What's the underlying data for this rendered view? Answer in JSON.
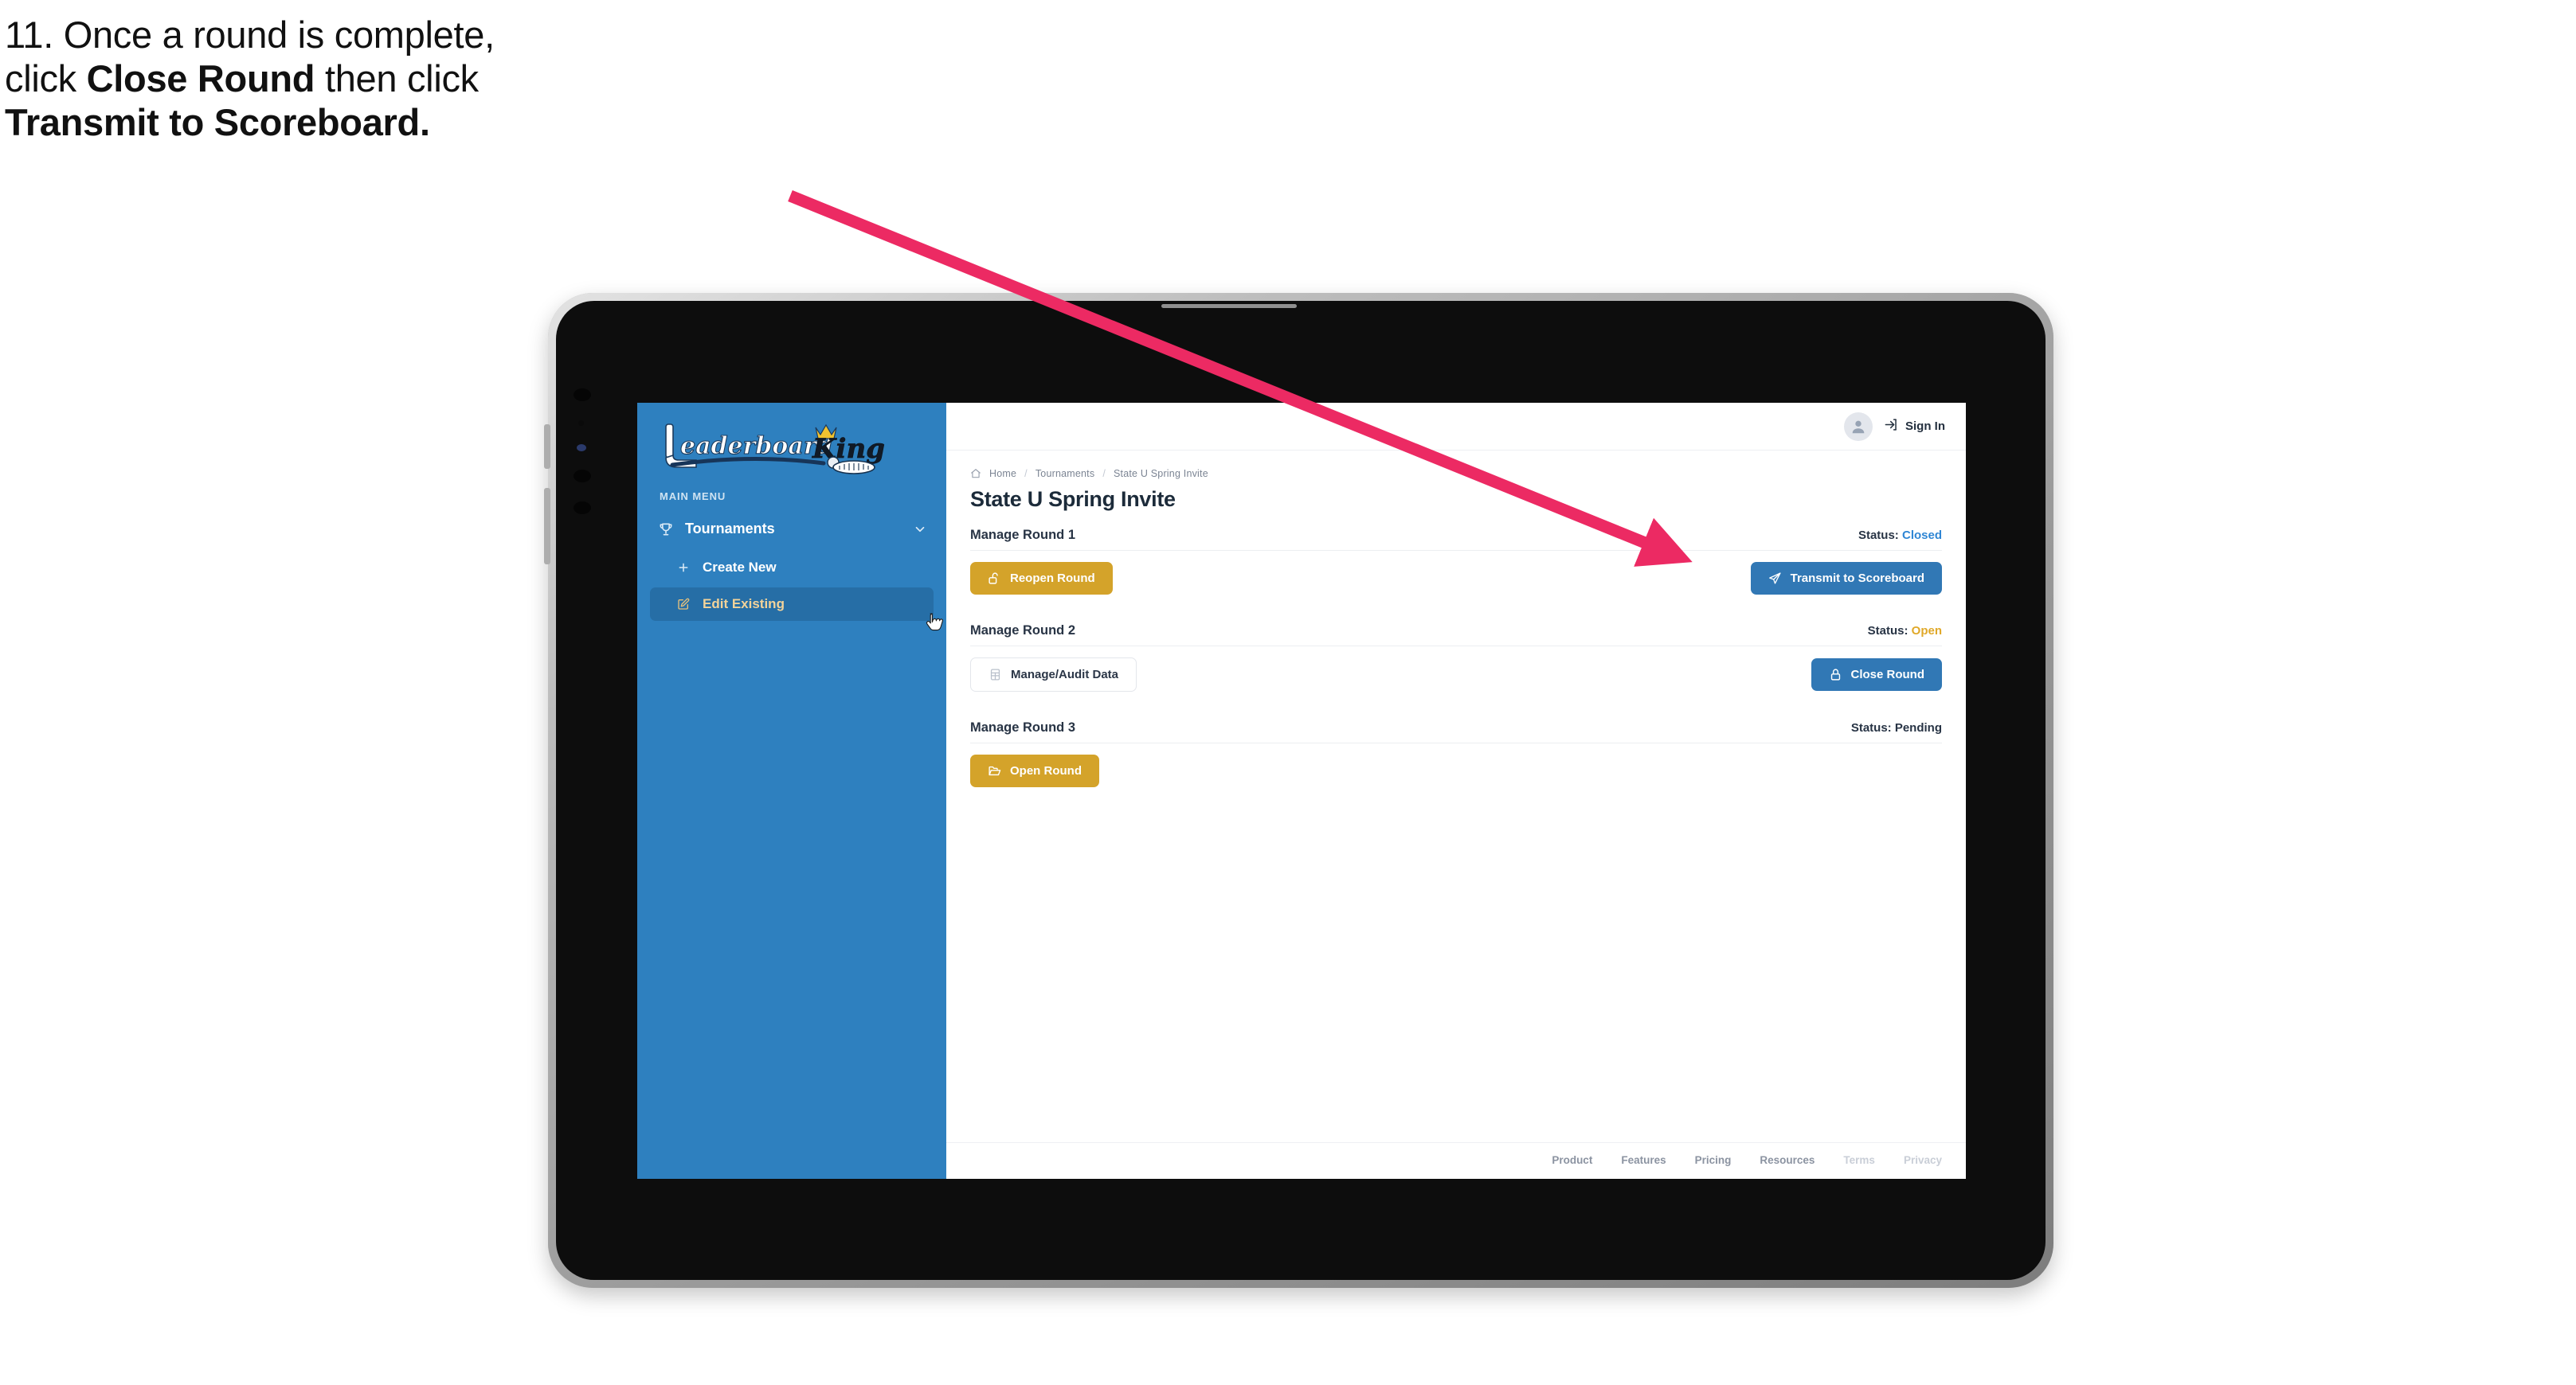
{
  "caption": {
    "line1_prefix": "11. Once a round is complete,",
    "line2_prefix": "click ",
    "line2_bold": "Close Round",
    "line2_suffix": " then click",
    "line3_bold": "Transmit to Scoreboard."
  },
  "annotation": {
    "arrow_color": "#ec2a63",
    "points_to": "Transmit to Scoreboard"
  },
  "app": {
    "sidebar": {
      "logo_text": "LeaderboardKing",
      "logo_word_1": "Leaderboard",
      "logo_word_2": "King",
      "section_label": "MAIN MENU",
      "items": [
        {
          "label": "Tournaments",
          "icon": "trophy-icon",
          "expanded": true,
          "chevron": "chevron-down-icon"
        },
        {
          "label": "Create New",
          "icon": "plus-icon",
          "active": false
        },
        {
          "label": "Edit Existing",
          "icon": "edit-pencil-icon",
          "active": true
        }
      ],
      "bg_color": "#2e80bf",
      "active_bg_color": "#266ea6",
      "active_text_color": "#f2d39a"
    },
    "topbar": {
      "avatar_icon": "user-avatar-icon",
      "signin_icon": "sign-in-arrow-icon",
      "signin_label": "Sign In"
    },
    "breadcrumb": {
      "home_icon": "home-icon",
      "items": [
        "Home",
        "Tournaments",
        "State U Spring Invite"
      ],
      "separator": "/"
    },
    "page_title": "State U Spring Invite",
    "rounds": [
      {
        "name": "Manage Round 1",
        "status_label": "Status:",
        "status_value": "Closed",
        "status_style": "closed",
        "status_color": "#2f86d4",
        "left_button": {
          "label": "Reopen Round",
          "icon": "unlock-icon",
          "style": "gold",
          "color": "#d4a32a"
        },
        "right_button": {
          "label": "Transmit to Scoreboard",
          "icon": "send-paper-plane-icon",
          "style": "blue",
          "color": "#3178b5"
        }
      },
      {
        "name": "Manage Round 2",
        "status_label": "Status:",
        "status_value": "Open",
        "status_style": "open",
        "status_color": "#e0a828",
        "left_button": {
          "label": "Manage/Audit Data",
          "icon": "spreadsheet-icon",
          "style": "ghost",
          "color": "#ffffff"
        },
        "right_button": {
          "label": "Close Round",
          "icon": "lock-icon",
          "style": "blue",
          "color": "#3178b5"
        }
      },
      {
        "name": "Manage Round 3",
        "status_label": "Status:",
        "status_value": "Pending",
        "status_style": "pending",
        "status_color": "#283445",
        "left_button": {
          "label": "Open Round",
          "icon": "open-folder-icon",
          "style": "gold",
          "color": "#d4a32a"
        },
        "right_button": null
      }
    ],
    "footer_links": [
      {
        "label": "Product",
        "dim": false
      },
      {
        "label": "Features",
        "dim": false
      },
      {
        "label": "Pricing",
        "dim": false
      },
      {
        "label": "Resources",
        "dim": false
      },
      {
        "label": "Terms",
        "dim": true
      },
      {
        "label": "Privacy",
        "dim": true
      }
    ]
  }
}
